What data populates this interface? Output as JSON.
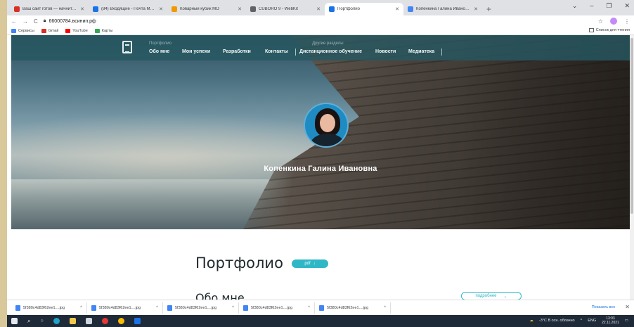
{
  "browser": {
    "tabs": [
      {
        "title": "Ваш сайт готов — начните его …",
        "favicon_color": "#d93025",
        "active": false
      },
      {
        "title": "(84) Входящие - Почта Mail.ru",
        "favicon_color": "#1a73e8",
        "active": false
      },
      {
        "title": "Коварный кубик МО",
        "favicon_color": "#f29900",
        "active": false
      },
      {
        "title": "CUBORO 9 - WebKit",
        "favicon_color": "#5f6368",
        "active": false
      },
      {
        "title": "Портфолио",
        "favicon_color": "#1a73e8",
        "active": true
      },
      {
        "title": "Копенкина Галина Ивановна",
        "favicon_color": "#4285f4",
        "active": false
      }
    ],
    "new_tab": "+",
    "window_controls": [
      "⌄",
      "–",
      "❐",
      "✕"
    ],
    "nav": {
      "back": "←",
      "forward": "→",
      "reload": "C"
    },
    "address": "66000784.всинип.рф",
    "lock_icon": "lock-icon",
    "bookmarks": [
      {
        "label": "Сервисы",
        "color": "#4285f4"
      },
      {
        "label": "Gmail",
        "color": "#d93025"
      },
      {
        "label": "YouTube",
        "color": "#ff0000"
      },
      {
        "label": "Карты",
        "color": "#34a853"
      }
    ],
    "reading_list": "Список для чтения"
  },
  "site": {
    "nav_groups": {
      "portfolio": "Портфолио",
      "other": "Другие разделы"
    },
    "nav_items": [
      "Обо мне",
      "Мои успехи",
      "Разработки",
      "Контакты",
      "Дистанционное обучение",
      "Новости",
      "Медиатека"
    ],
    "hero_name": "Копенкина Галина Ивановна",
    "portfolio_title": "Портфолио",
    "pdf_label": "pdf",
    "about_title": "Обо мне",
    "more_label": "подробнее"
  },
  "downloads": {
    "items": [
      "5f380c4d83f62ee1....jpg",
      "5f380c4d83f62ee1....jpg",
      "5f380c4d83f62ee1....jpg",
      "5f380c4d83f62ee1....jpg",
      "5f380c4d83f62ee1....jpg"
    ],
    "show_all": "Показать все"
  },
  "taskbar": {
    "weather": "-3°C  В осн. облачно",
    "lang": "ENG",
    "time": "13:03",
    "date": "22.11.2021"
  },
  "colors": {
    "accent": "#2fb7c7",
    "navbar": "#265860",
    "title_text": "#1f2a2e"
  }
}
